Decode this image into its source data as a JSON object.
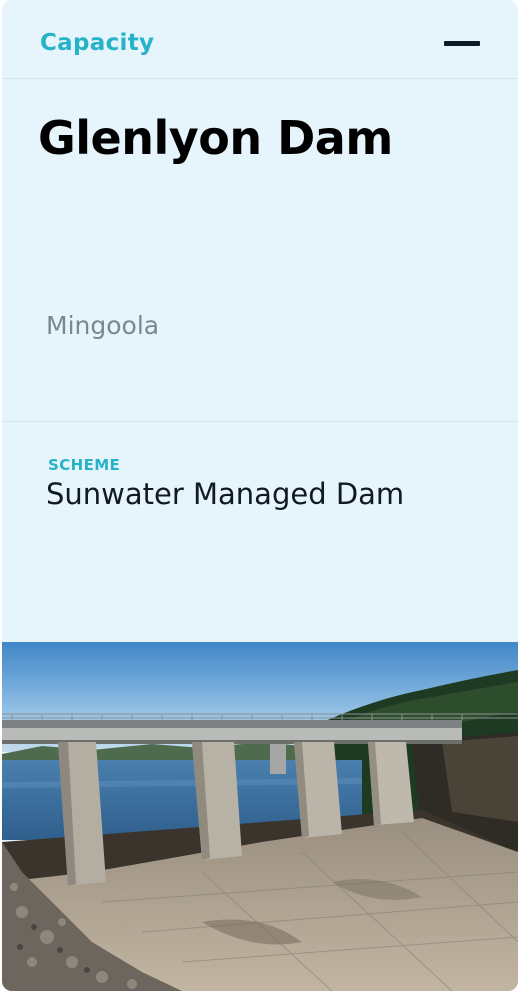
{
  "header": {
    "tab_label": "Capacity",
    "collapse_icon": "minus-icon"
  },
  "dam": {
    "name": "Glenlyon Dam",
    "location": "Mingoola"
  },
  "scheme": {
    "label": "SCHEME",
    "value": "Sunwater Managed Dam"
  },
  "photo": {
    "subject": "dam-spillway-photo"
  },
  "colors": {
    "card_bg": "#e6f5fb",
    "accent": "#26b2c9",
    "title": "#000000",
    "muted": "#7a8892"
  }
}
